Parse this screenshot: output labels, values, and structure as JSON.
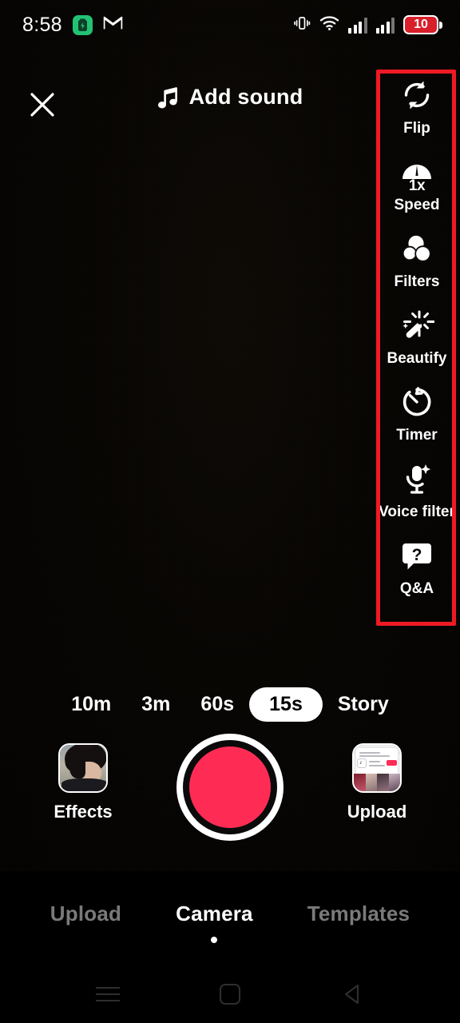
{
  "status_bar": {
    "time": "8:58",
    "battery_saver_icon": "battery-saver-icon",
    "gmail_icon": "gmail-icon",
    "vibrate_icon": "vibrate-icon",
    "wifi_icon": "wifi-icon",
    "signal_1_icon": "signal-bars-icon",
    "signal_2_icon": "signal-bars-icon",
    "battery_percent": "10"
  },
  "top_bar": {
    "close_icon": "close-icon",
    "add_sound_label": "Add sound",
    "music_note_icon": "music-note-icon"
  },
  "tool_rail": {
    "items": [
      {
        "label": "Flip",
        "icon": "flip-camera-icon"
      },
      {
        "label": "Speed",
        "icon": "speedometer-icon",
        "value": "1x"
      },
      {
        "label": "Filters",
        "icon": "filters-circles-icon"
      },
      {
        "label": "Beautify",
        "icon": "magic-wand-icon"
      },
      {
        "label": "Timer",
        "icon": "timer-icon"
      },
      {
        "label": "Voice filter",
        "icon": "microphone-sparkle-icon"
      },
      {
        "label": "Q&A",
        "icon": "question-bubble-icon"
      }
    ],
    "highlight_color": "#ef1a24"
  },
  "durations": {
    "options": [
      "10m",
      "3m",
      "60s",
      "15s",
      "Story"
    ],
    "selected": "15s"
  },
  "capture": {
    "effects_label": "Effects",
    "upload_label": "Upload",
    "record_button_color": "#fe2c55",
    "effects_icon": "effects-thumbnail",
    "upload_icon": "upload-thumbnail",
    "record_icon": "record-button"
  },
  "bottom_tabs": {
    "items": [
      "Upload",
      "Camera",
      "Templates"
    ],
    "active": "Camera"
  },
  "nav_bar": {
    "recents_icon": "recents-icon",
    "home_icon": "home-icon",
    "back_icon": "back-icon"
  }
}
